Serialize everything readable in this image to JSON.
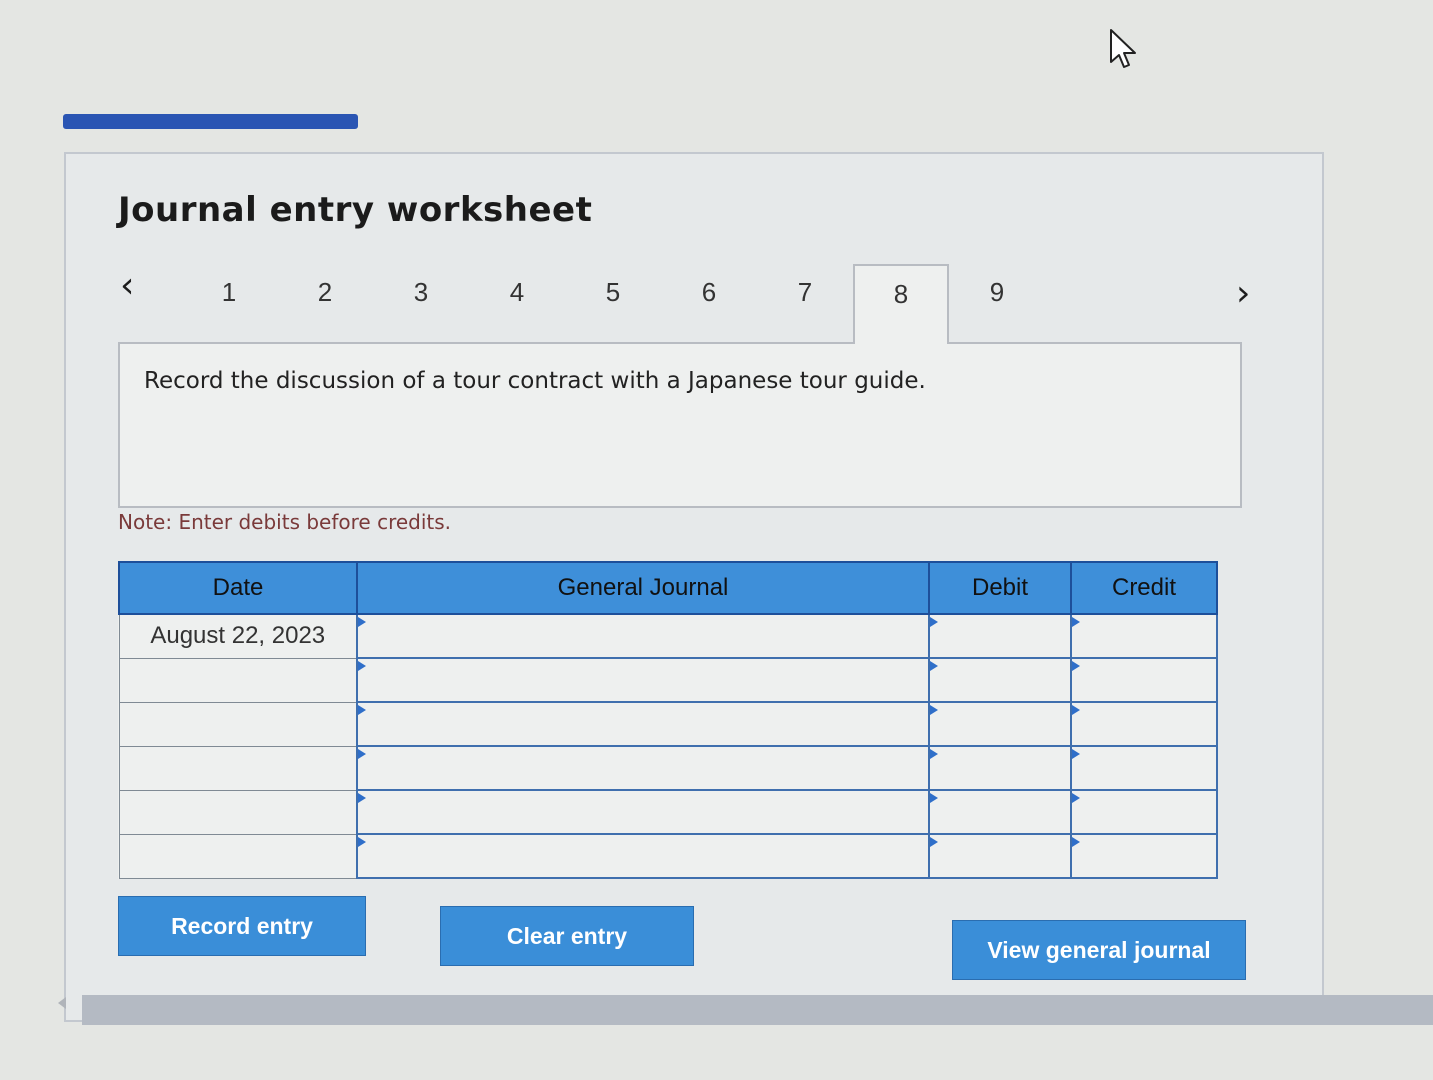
{
  "worksheet": {
    "title": "Journal entry worksheet",
    "tabs": [
      "1",
      "2",
      "3",
      "4",
      "5",
      "6",
      "7",
      "8",
      "9"
    ],
    "active_tab": "8",
    "nav_prev": "‹",
    "nav_next": "›",
    "instruction": "Record the discussion of a tour contract with a Japanese tour guide.",
    "note": "Note: Enter debits before credits."
  },
  "journal": {
    "headers": {
      "date": "Date",
      "general_journal": "General Journal",
      "debit": "Debit",
      "credit": "Credit"
    },
    "rows": [
      {
        "date": "August 22, 2023",
        "account": "",
        "debit": "",
        "credit": ""
      },
      {
        "date": "",
        "account": "",
        "debit": "",
        "credit": ""
      },
      {
        "date": "",
        "account": "",
        "debit": "",
        "credit": ""
      },
      {
        "date": "",
        "account": "",
        "debit": "",
        "credit": ""
      },
      {
        "date": "",
        "account": "",
        "debit": "",
        "credit": ""
      },
      {
        "date": "",
        "account": "",
        "debit": "",
        "credit": ""
      }
    ]
  },
  "buttons": {
    "record": "Record entry",
    "clear": "Clear entry",
    "view": "View general journal"
  },
  "colors": {
    "header_blue": "#3e8fd9",
    "button_blue": "#3a8ed8",
    "progress_bar": "#2a55b3"
  },
  "icons": [
    "mouse-cursor-icon",
    "chevron-left-icon",
    "chevron-right-icon",
    "scroll-left-icon"
  ]
}
